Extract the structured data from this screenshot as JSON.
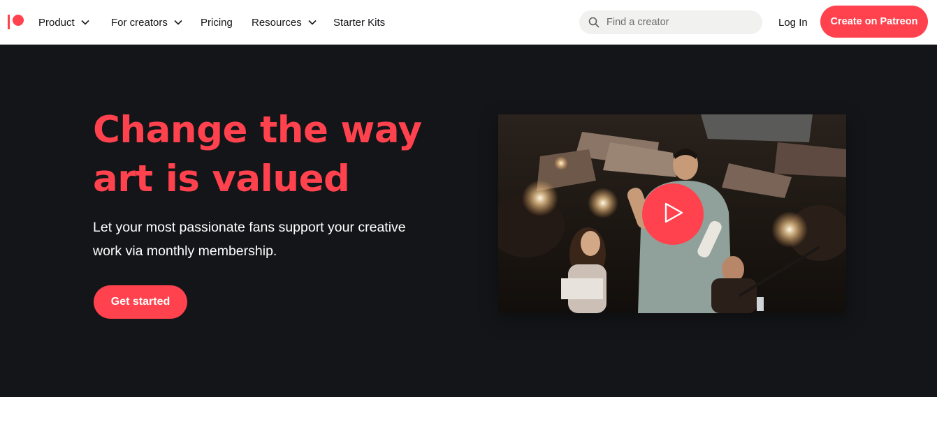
{
  "brand": {
    "logo_icon": "patreon-logo-icon",
    "accent": "#ff424d",
    "dark_bg": "#141518"
  },
  "nav": {
    "items": [
      {
        "label": "Product",
        "has_dropdown": true
      },
      {
        "label": "For creators",
        "has_dropdown": true
      },
      {
        "label": "Pricing",
        "has_dropdown": false
      },
      {
        "label": "Resources",
        "has_dropdown": true
      },
      {
        "label": "Starter Kits",
        "has_dropdown": false
      }
    ]
  },
  "search": {
    "placeholder": "Find a creator",
    "value": "",
    "icon": "search-icon"
  },
  "header_actions": {
    "login_label": "Log In",
    "cta_label": "Create on Patreon"
  },
  "hero": {
    "headline_line1": "Change the way",
    "headline_line2": "art is valued",
    "subhead_line1": "Let your most passionate fans support your creative",
    "subhead_line2": "work via monthly membership.",
    "cta_label": "Get started",
    "video": {
      "play_icon": "play-icon"
    }
  }
}
